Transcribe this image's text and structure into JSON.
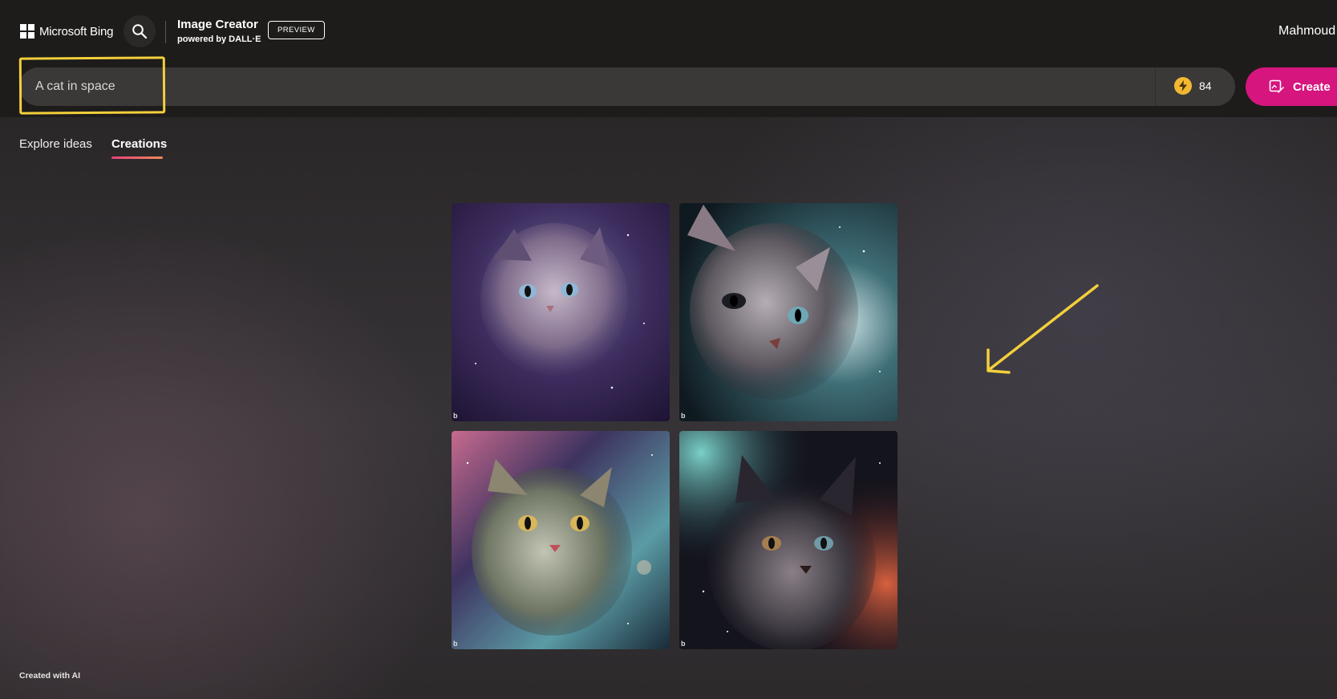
{
  "header": {
    "brand": "Microsoft Bing",
    "app_title": "Image Creator",
    "app_subtitle": "powered by DALL·E",
    "badge": "PREVIEW",
    "user_name": "Mahmoud"
  },
  "prompt": {
    "value": "A cat in space",
    "boosts": "84",
    "create_label": "Create"
  },
  "tabs": [
    {
      "label": "Explore ideas",
      "active": false
    },
    {
      "label": "Creations",
      "active": true
    }
  ],
  "images": [
    {
      "watermark": "b"
    },
    {
      "watermark": "b"
    },
    {
      "watermark": "b"
    },
    {
      "watermark": "b"
    }
  ],
  "colors": {
    "accent": "#d6157e",
    "annotation": "#f3cf3b",
    "coin": "#f2b832"
  },
  "footer": {
    "note": "Created with AI"
  }
}
